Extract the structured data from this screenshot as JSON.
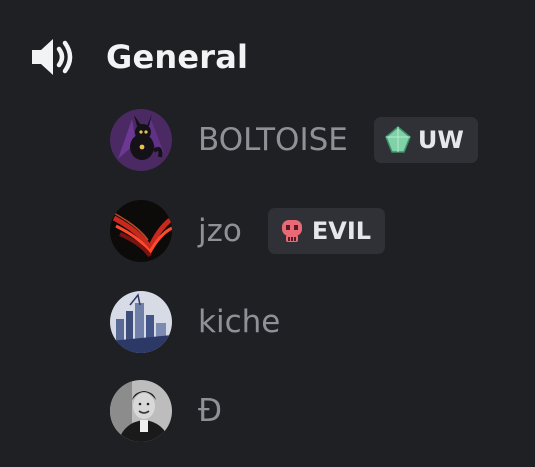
{
  "channel": {
    "icon": "speaker-icon",
    "name": "General"
  },
  "members": [
    {
      "name": "BOLTOISE",
      "avatar": "umbreon-avatar",
      "tag": {
        "icon": "green-gem-icon",
        "label": "UW",
        "color": "#7fd1a8"
      }
    },
    {
      "name": "jzo",
      "avatar": "red-swoosh-avatar",
      "tag": {
        "icon": "red-skull-icon",
        "label": "EVIL",
        "color": "#e86a76"
      }
    },
    {
      "name": "kiche",
      "avatar": "city-sketch-avatar"
    },
    {
      "name": "Đ",
      "avatar": "portrait-avatar"
    }
  ],
  "colors": {
    "background": "#1f2024",
    "member_text": "#8e9297",
    "channel_text": "#f2f3f5",
    "tag_background": "#2f3136"
  }
}
